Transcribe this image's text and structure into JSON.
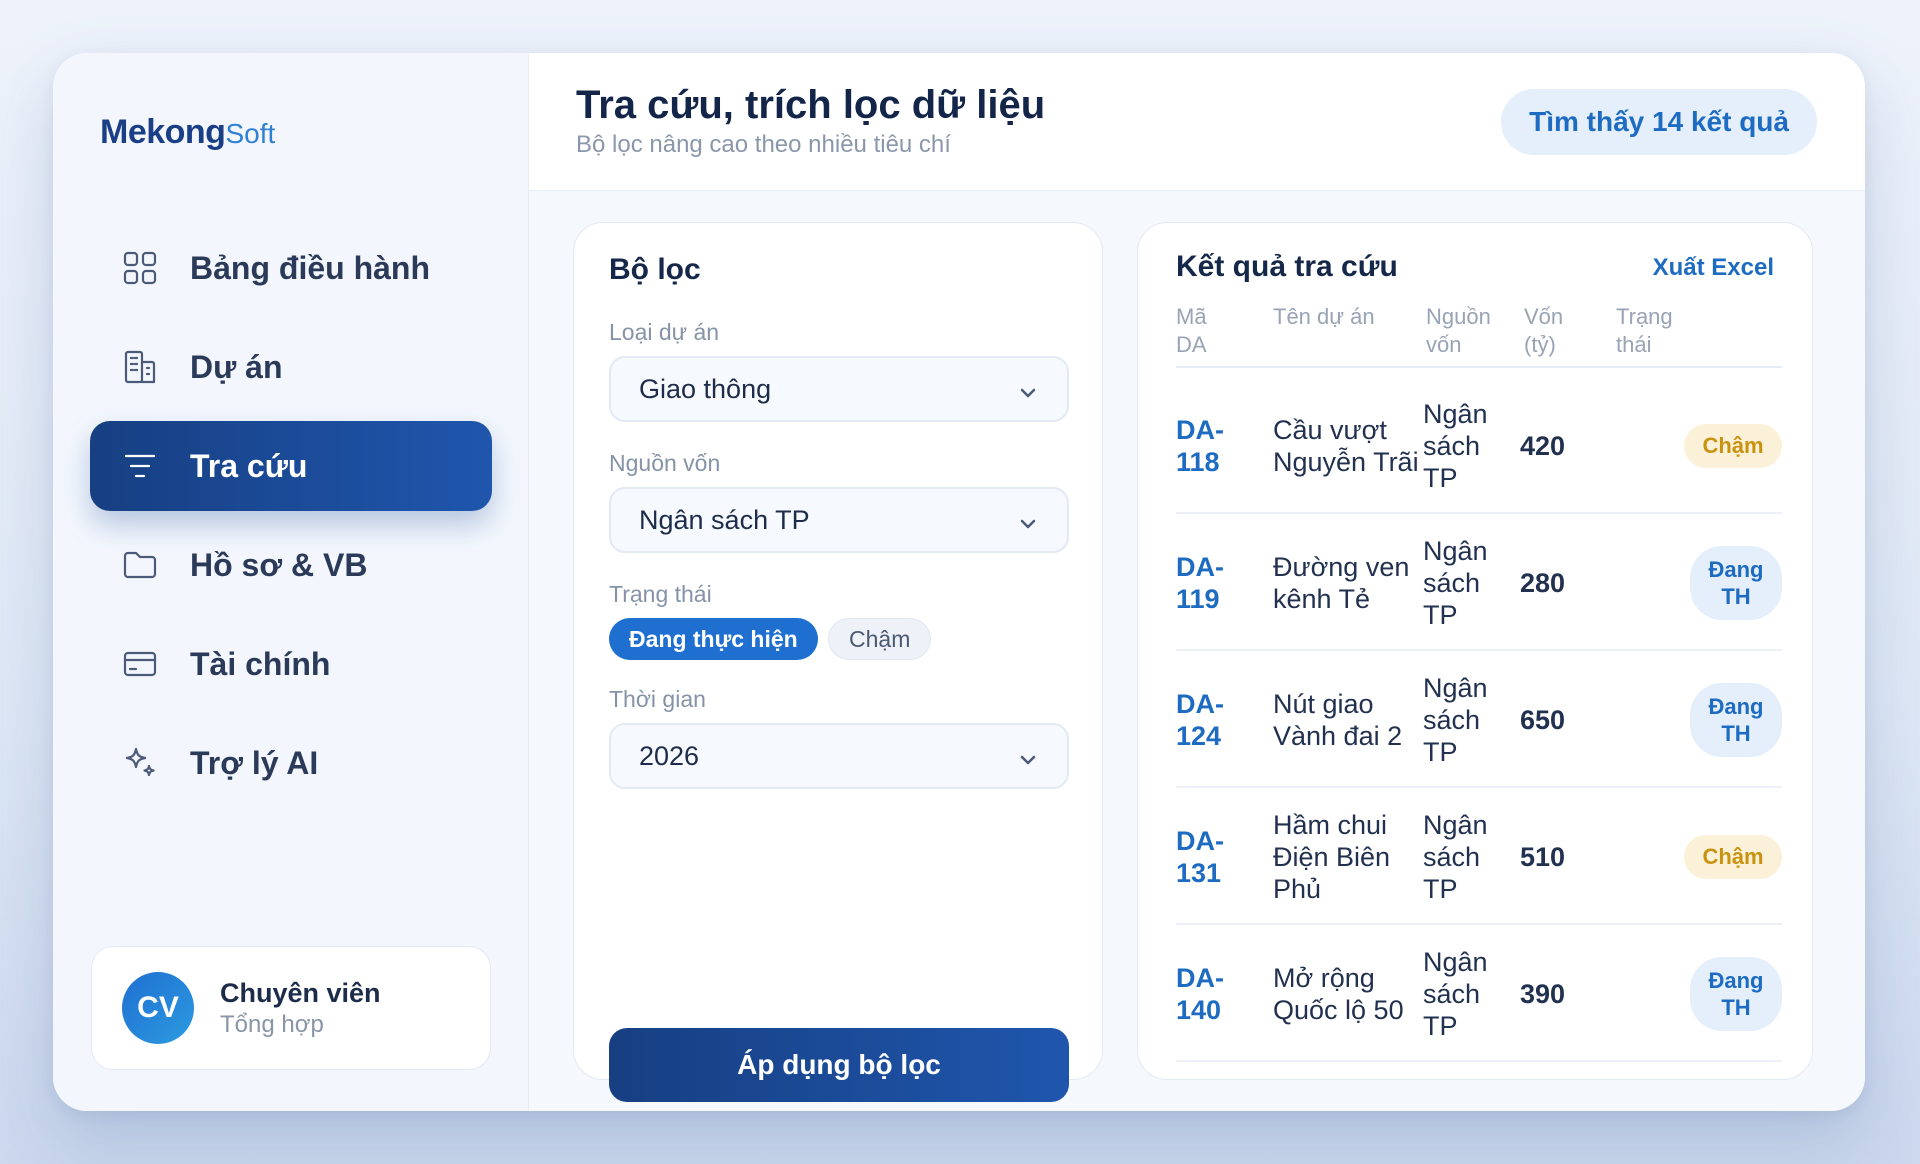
{
  "brand": {
    "logo_main": "Mekong",
    "logo_sub": "Soft"
  },
  "sidebar": {
    "items": [
      {
        "label": "Bảng điều hành",
        "icon": "dashboard-grid-icon",
        "active": false
      },
      {
        "label": "Dự án",
        "icon": "building-icon",
        "active": false
      },
      {
        "label": "Tra cứu",
        "icon": "filter-icon",
        "active": true
      },
      {
        "label": "Hồ sơ & VB",
        "icon": "folder-icon",
        "active": false
      },
      {
        "label": "Tài chính",
        "icon": "credit-card-icon",
        "active": false
      },
      {
        "label": "Trợ lý AI",
        "icon": "sparkle-icon",
        "active": false
      }
    ]
  },
  "user": {
    "initials": "CV",
    "name": "Chuyên viên",
    "role": "Tổng hợp"
  },
  "header": {
    "title": "Tra cứu, trích lọc dữ liệu",
    "subtitle": "Bộ lọc nâng cao theo nhiều tiêu chí",
    "result_count": "Tìm thấy 14 kết quả"
  },
  "filter": {
    "title": "Bộ lọc",
    "project_type_label": "Loại dự án",
    "project_type_value": "Giao thông",
    "funding_label": "Nguồn vốn",
    "funding_value": "Ngân sách TP",
    "status_label": "Trạng thái",
    "status_chips": [
      {
        "label": "Đang thực hiện",
        "selected": true
      },
      {
        "label": "Chậm",
        "selected": false
      }
    ],
    "time_label": "Thời gian",
    "time_value": "2026",
    "apply_label": "Áp dụng bộ lọc"
  },
  "results": {
    "title": "Kết quả tra cứu",
    "export_label": "Xuất Excel",
    "columns": [
      [
        "Mã",
        "DA"
      ],
      [
        "Tên dự án"
      ],
      [
        "Nguồn",
        "vốn"
      ],
      [
        "Vốn",
        "(tỷ)"
      ],
      [
        "Trạng",
        "thái"
      ]
    ],
    "rows": [
      {
        "code": [
          "DA-",
          "118"
        ],
        "name": [
          "Cầu vượt",
          "Nguyễn Trãi"
        ],
        "source": [
          "Ngân",
          "sách",
          "TP"
        ],
        "capital": "420",
        "status": [
          "Chậm"
        ],
        "status_type": "slow"
      },
      {
        "code": [
          "DA-",
          "119"
        ],
        "name": [
          "Đường ven",
          "kênh Tẻ"
        ],
        "source": [
          "Ngân",
          "sách",
          "TP"
        ],
        "capital": "280",
        "status": [
          "Đang",
          "TH"
        ],
        "status_type": "active"
      },
      {
        "code": [
          "DA-",
          "124"
        ],
        "name": [
          "Nút giao",
          "Vành đai 2"
        ],
        "source": [
          "Ngân",
          "sách",
          "TP"
        ],
        "capital": "650",
        "status": [
          "Đang",
          "TH"
        ],
        "status_type": "active"
      },
      {
        "code": [
          "DA-",
          "131"
        ],
        "name": [
          "Hầm chui",
          "Điện Biên",
          "Phủ"
        ],
        "source": [
          "Ngân",
          "sách",
          "TP"
        ],
        "capital": "510",
        "status": [
          "Chậm"
        ],
        "status_type": "slow"
      },
      {
        "code": [
          "DA-",
          "140"
        ],
        "name": [
          "Mở rộng",
          "Quốc lộ 50"
        ],
        "source": [
          "Ngân",
          "sách",
          "TP"
        ],
        "capital": "390",
        "status": [
          "Đang",
          "TH"
        ],
        "status_type": "active"
      }
    ]
  },
  "colors": {
    "primary_dark": "#173f82",
    "primary": "#1f56ad",
    "accent_blue": "#1e6bc2",
    "slow_badge_text": "#c99310",
    "slow_badge_bg": "#fbf1d9"
  }
}
